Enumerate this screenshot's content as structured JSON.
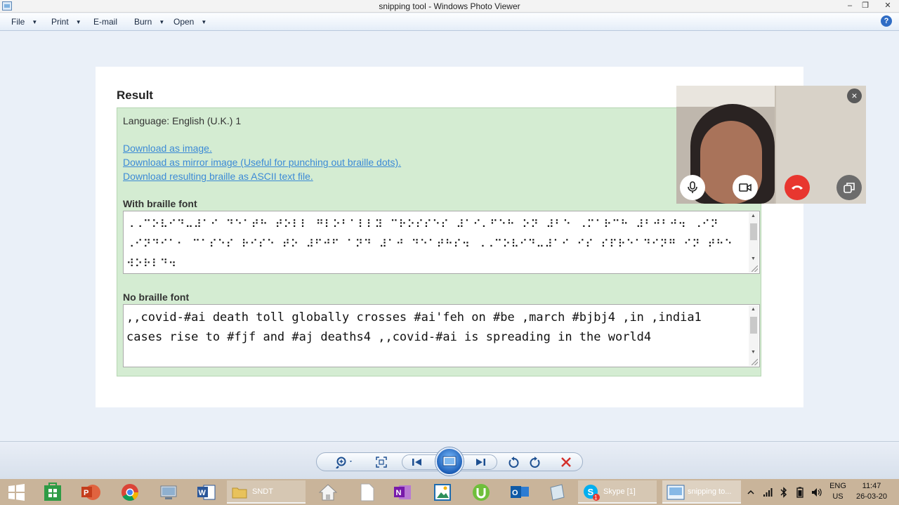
{
  "window": {
    "title": "snipping tool - Windows Photo Viewer",
    "controls": {
      "minimize": "–",
      "restore": "❐",
      "close": "✕"
    }
  },
  "menubar": {
    "file": "File",
    "print": "Print",
    "email": "E-mail",
    "burn": "Burn",
    "open": "Open",
    "help": "?"
  },
  "result": {
    "heading": "Result",
    "language": "Language: English (U.K.) 1",
    "links": {
      "image": "Download as image.",
      "mirror": "Download as mirror image (Useful for punching out braille dots).",
      "ascii": "Download resulting braille as ASCII text file."
    },
    "braille_label": "With braille font",
    "braille_text": "⠠⠠⠉⠕⠧⠊⠙⠤⠼⠁⠊ ⠙⠑⠁⠞⠓ ⠞⠕⠇⠇ ⠛⠇⠕⠃⠁⠇⠇⠽ ⠉⠗⠕⠎⠎⠑⠎ ⠼⠁⠊⠄⠋⠑⠓ ⠕⠝ ⠼⠃⠑ ⠠⠍⠁⠗⠉⠓ ⠼⠃⠚⠃⠚⠲ ⠠⠊⠝ ⠠⠊⠝⠙⠊⠁⠂ ⠉⠁⠎⠑⠎ ⠗⠊⠎⠑ ⠞⠕ ⠼⠋⠚⠋ ⠁⠝⠙ ⠼⠁⠚ ⠙⠑⠁⠞⠓⠎⠲ ⠠⠠⠉⠕⠧⠊⠙⠤⠼⠁⠊ ⠊⠎ ⠎⠏⠗⠑⠁⠙⠊⠝⠛ ⠊⠝ ⠞⠓⠑ ⠺⠕⠗⠇⠙⠲",
    "plain_label": "No braille font",
    "plain_text": ",,covid-#ai death toll globally crosses #ai'feh on #be ,march #bjbj4 ,in ,india1 cases rise to #fjf and #aj deaths4 ,,covid-#ai is spreading in the world4"
  },
  "video_call": {
    "close": "×"
  },
  "taskbar": {
    "folder_label": "SNDT",
    "skype_label": "Skype [1]",
    "skype_badge": "1",
    "photo_label": "snipping to...",
    "lang_top": "ENG",
    "lang_bottom": "US",
    "time": "11:47",
    "date": "26-03-20"
  },
  "colors": {
    "result_bg": "#d4ecd2",
    "link": "#3c8ad6",
    "end_call": "#e8362f",
    "taskbar": "#c9b49a"
  }
}
